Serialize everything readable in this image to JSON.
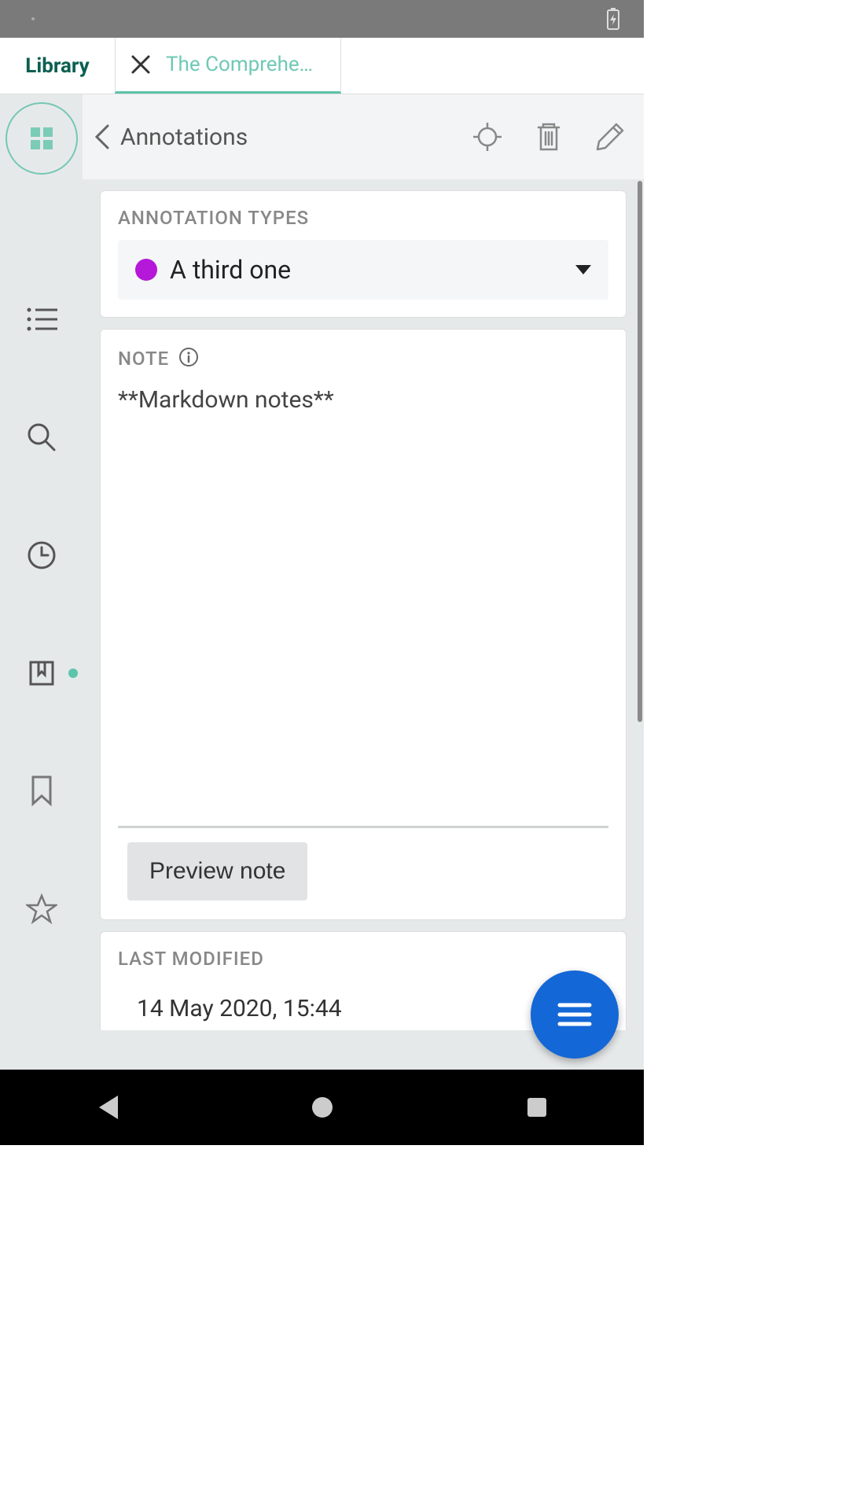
{
  "tabs": {
    "library_label": "Library",
    "document_title": "The Comprehe…"
  },
  "header": {
    "title": "Annotations"
  },
  "annotation_types": {
    "label": "ANNOTATION TYPES",
    "selected": "A third one",
    "color": "#b518d8"
  },
  "note": {
    "label": "NOTE",
    "content": "**Markdown notes**",
    "preview_button": "Preview note"
  },
  "last_modified": {
    "label": "LAST MODIFIED",
    "value": "14 May 2020, 15:44"
  },
  "icons": {
    "grid": "grid-icon",
    "list": "list-icon",
    "search": "search-icon",
    "clock": "clock-icon",
    "bookmark_badge": "bookmark-collection-icon",
    "bookmark": "bookmark-icon",
    "star": "star-icon",
    "back": "chevron-left-icon",
    "target": "crosshair-icon",
    "trash": "trash-icon",
    "pencil": "pencil-icon",
    "info": "info-icon",
    "caret": "caret-down-icon",
    "menu": "menu-icon",
    "nav_back": "nav-back-icon",
    "nav_home": "nav-home-icon",
    "nav_recent": "nav-recent-icon",
    "battery": "battery-icon",
    "close": "close-icon"
  },
  "colors": {
    "accent_teal": "#5ec2aa",
    "library_text": "#0a5f52",
    "fab": "#1467d6",
    "annotation_dot": "#b518d8"
  }
}
